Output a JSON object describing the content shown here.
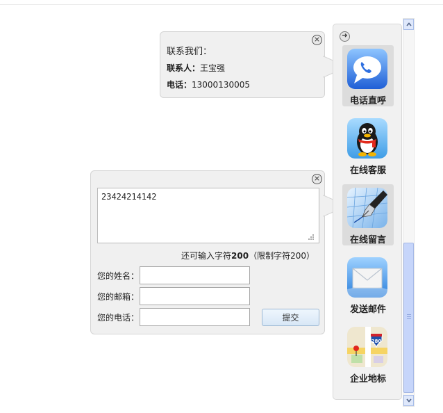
{
  "contact_popup": {
    "title": "联系我们：",
    "person_label": "联系人：",
    "person_value": "王宝强",
    "phone_label": "电话：",
    "phone_value": "13000130005",
    "close_glyph": "×"
  },
  "message_popup": {
    "message_value": "23424214142",
    "counter_prefix": "还可输入字符",
    "counter_remaining": "200",
    "counter_suffix": "（限制字符200）",
    "name_label": "您的姓名：",
    "email_label": "您的邮箱：",
    "phone_label": "您的电话：",
    "name_value": "",
    "email_value": "",
    "phone_value": "",
    "submit_label": "提交",
    "close_glyph": "×"
  },
  "side_panel": {
    "collapse_glyph": "➜",
    "items": [
      {
        "label": "电话直呼",
        "icon": "phone-bubble-icon",
        "active": true
      },
      {
        "label": "在线客服",
        "icon": "qq-penguin-icon",
        "active": false
      },
      {
        "label": "在线留言",
        "icon": "fountain-pen-icon",
        "active": true
      },
      {
        "label": "发送邮件",
        "icon": "mail-envelope-icon",
        "active": false
      },
      {
        "label": "企业地标",
        "icon": "map-icon",
        "active": false
      }
    ],
    "map_shield_text": "280"
  },
  "colors": {
    "panel_bg": "#f1f1f1",
    "popup_bg": "#f0f0f0",
    "scroll_thumb": "#c6d5fa",
    "submit_bg": "#dde9f7"
  }
}
